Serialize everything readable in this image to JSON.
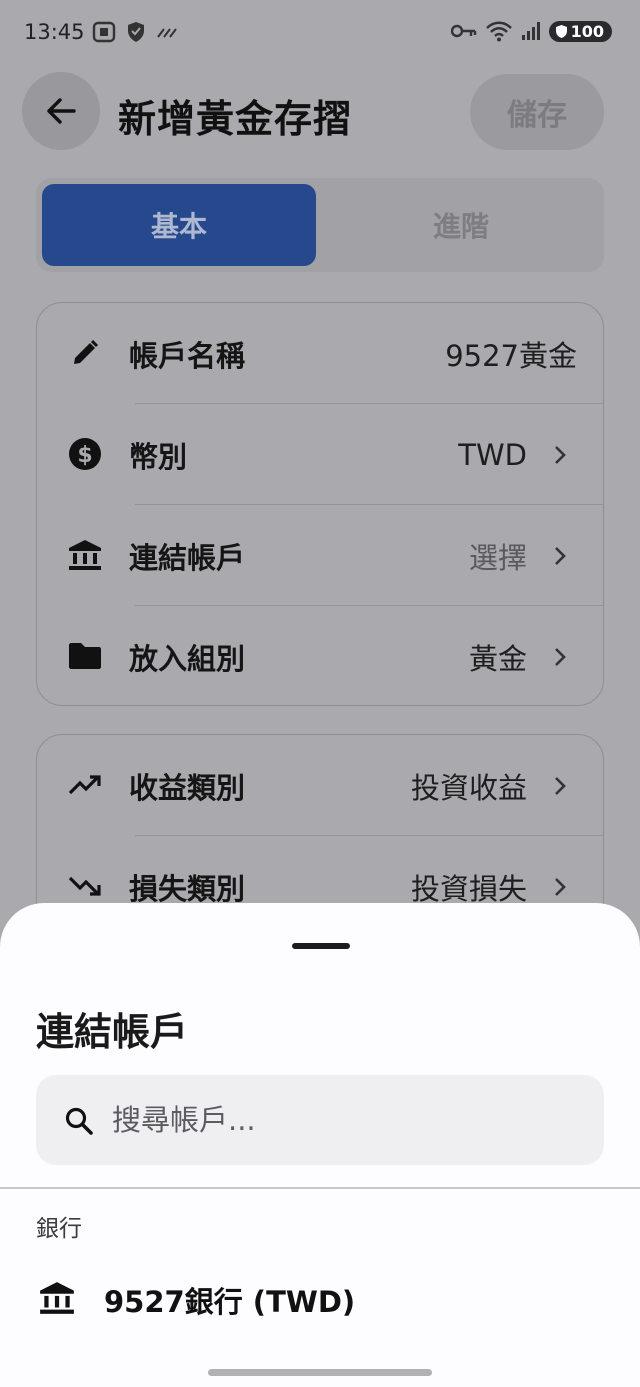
{
  "status_bar": {
    "time": "13:45",
    "battery": "100"
  },
  "header": {
    "title": "新增黃金存摺",
    "save_label": "儲存"
  },
  "tabs": [
    {
      "label": "基本",
      "active": true
    },
    {
      "label": "進階",
      "active": false
    }
  ],
  "settings_card_1": [
    {
      "icon": "pencil-icon",
      "label": "帳戶名稱",
      "value": "9527黃金",
      "has_arrow": false
    },
    {
      "icon": "dollar-icon",
      "label": "幣別",
      "value": "TWD",
      "has_arrow": true
    },
    {
      "icon": "bank-icon",
      "label": "連結帳戶",
      "value": "選擇",
      "has_arrow": true
    },
    {
      "icon": "folder-icon",
      "label": "放入組別",
      "value": "黃金",
      "has_arrow": true
    }
  ],
  "settings_card_2": [
    {
      "icon": "trending-up-icon",
      "label": "收益類別",
      "value": "投資收益",
      "has_arrow": true
    },
    {
      "icon": "trending-down-icon",
      "label": "損失類別",
      "value": "投資損失",
      "has_arrow": true
    }
  ],
  "sheet": {
    "title": "連結帳戶",
    "search_placeholder": "搜尋帳戶...",
    "section_label": "銀行",
    "accounts": [
      {
        "icon": "bank-icon",
        "name": "9527銀行 (TWD)"
      }
    ]
  },
  "colors": {
    "accent": "#26498d",
    "scrim": "#a9a9ae",
    "sheet_bg": "#fdfcff"
  }
}
